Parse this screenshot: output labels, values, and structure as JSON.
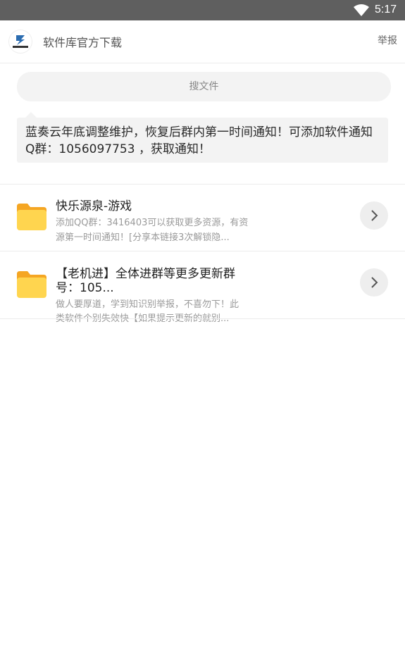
{
  "status_bar": {
    "time": "5:17",
    "wifi_icon": "wifi-icon"
  },
  "header": {
    "title": "软件库官方下载",
    "report_label": "举报",
    "logo_icon": "app-logo-icon"
  },
  "search": {
    "placeholder": "搜文件"
  },
  "notice": {
    "text": "蓝奏云年底调整维护，恢复后群内第一时间通知！可添加软件通知Q群：1056097753 ，获取通知！"
  },
  "files": [
    {
      "name": "快乐源泉-游戏",
      "desc_line1": "添加QQ群：3416403可以获取更多资源，有资",
      "desc_line2": "源第一时间通知！[分享本链接3次解锁隐...",
      "icon": "folder-icon"
    },
    {
      "name_line1": "【老机进】全体进群等更多更新群",
      "name_line2": "号：105...",
      "desc_line1": "做人要厚道，学到知识别举报，不喜勿下！此",
      "desc_line2": "类软件个别失效快【如果提示更新的就别...",
      "icon": "folder-icon"
    }
  ],
  "colors": {
    "folder_body": "#FFD54F",
    "folder_tab": "#F5A623",
    "status_bar": "#5f5f5f"
  }
}
